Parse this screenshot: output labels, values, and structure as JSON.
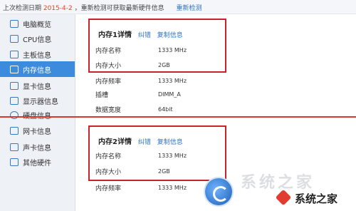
{
  "topbar": {
    "prefix": "上次检测日期",
    "date": "2015-4-2",
    "notice": "，重新检测可获取最新硬件信息",
    "recheck_link": "重新检测"
  },
  "sidebar": {
    "items": [
      {
        "label": "电脑概览",
        "icon": "monitor-icon"
      },
      {
        "label": "CPU信息",
        "icon": "cpu-icon"
      },
      {
        "label": "主板信息",
        "icon": "motherboard-icon"
      },
      {
        "label": "内存信息",
        "icon": "memory-icon",
        "active": true
      },
      {
        "label": "显卡信息",
        "icon": "graphics-card-icon"
      },
      {
        "label": "显示器信息",
        "icon": "display-icon"
      },
      {
        "label": "硬盘信息",
        "icon": "hard-disk-icon"
      },
      {
        "label": "网卡信息",
        "icon": "network-card-icon"
      },
      {
        "label": "声卡信息",
        "icon": "sound-card-icon"
      },
      {
        "label": "其他硬件",
        "icon": "other-hardware-icon"
      }
    ]
  },
  "memory1": {
    "title": "内存1详情",
    "correct_link": "纠错",
    "copy_link": "复制信息",
    "rows": [
      {
        "label": "内存名称",
        "value": "1333 MHz"
      },
      {
        "label": "内存大小",
        "value": "2GB"
      },
      {
        "label": "内存频率",
        "value": "1333 MHz"
      },
      {
        "label": "插槽",
        "value": "DIMM_A"
      },
      {
        "label": "数据宽度",
        "value": "64bit"
      }
    ]
  },
  "memory2": {
    "title": "内存2详情",
    "correct_link": "纠错",
    "copy_link": "复制信息",
    "rows": [
      {
        "label": "内存名称",
        "value": "1333 MHz"
      },
      {
        "label": "内存大小",
        "value": "2GB"
      },
      {
        "label": "内存频率",
        "value": "1333 MHz"
      }
    ]
  },
  "watermark": {
    "faint_text": "系统之家",
    "text": "系统之家"
  },
  "colors": {
    "accent": "#3d8bdc",
    "highlight_border": "#c8232c",
    "link": "#2d74c4",
    "date": "#e0452d"
  }
}
